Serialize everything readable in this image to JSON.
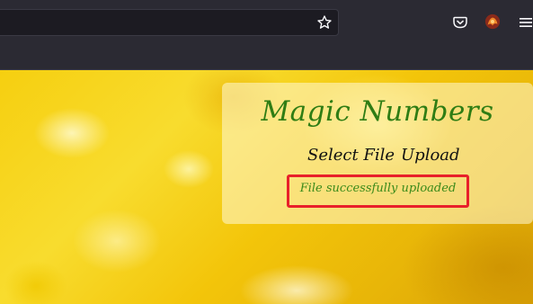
{
  "browser": {
    "toolbar_icons": [
      "star-icon",
      "pocket-icon",
      "avatar-icon",
      "menu-icon"
    ]
  },
  "page": {
    "title": "Magic Numbers",
    "nav": {
      "select_file_label": "Select File",
      "upload_label": "Upload"
    },
    "status_message": "File successfully uploaded",
    "colors": {
      "title": "#2f7d14",
      "status_text": "#3a8a1a",
      "highlight_box": "#e8202a",
      "background_accent": "#f6cf10"
    }
  }
}
